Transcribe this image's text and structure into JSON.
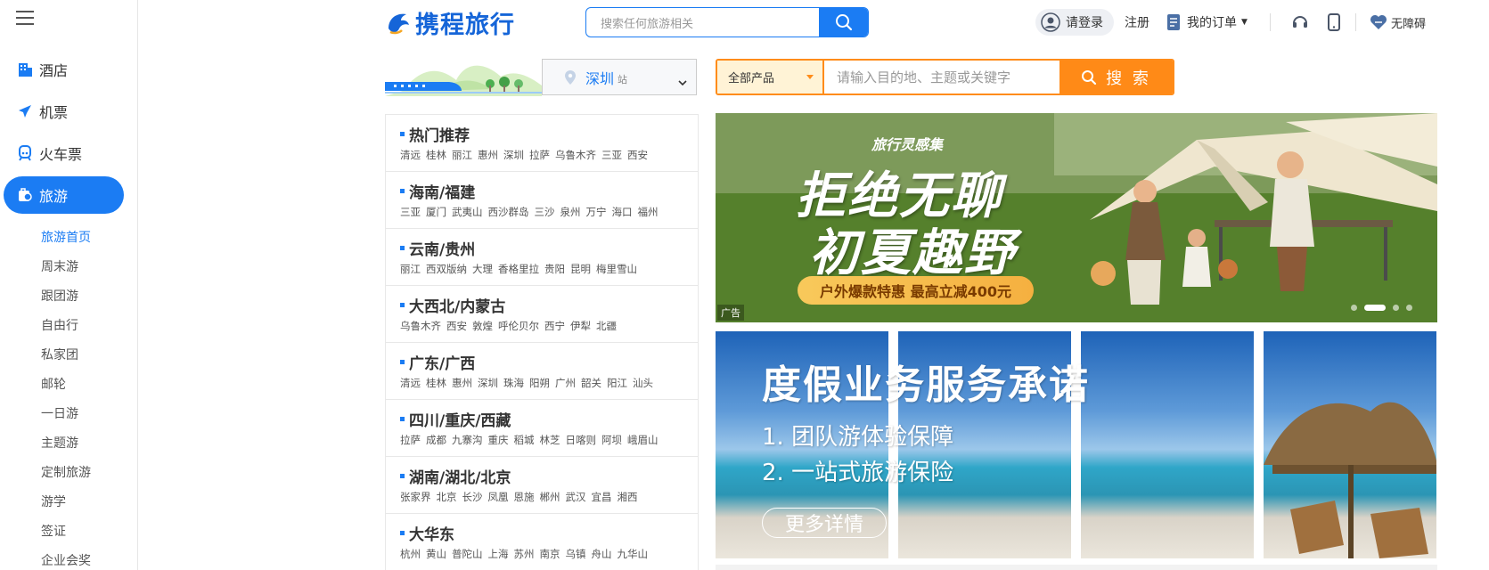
{
  "sidebar": {
    "nav": [
      {
        "label": "酒店",
        "icon": "hotel-icon"
      },
      {
        "label": "机票",
        "icon": "airplane-icon"
      },
      {
        "label": "火车票",
        "icon": "train-icon"
      },
      {
        "label": "旅游",
        "icon": "travel-icon",
        "active": true
      }
    ],
    "sub": [
      {
        "label": "旅游首页",
        "active": true
      },
      {
        "label": "周末游"
      },
      {
        "label": "跟团游"
      },
      {
        "label": "自由行"
      },
      {
        "label": "私家团"
      },
      {
        "label": "邮轮"
      },
      {
        "label": "一日游"
      },
      {
        "label": "主题游"
      },
      {
        "label": "定制旅游"
      },
      {
        "label": "游学"
      },
      {
        "label": "签证"
      },
      {
        "label": "企业会奖"
      }
    ]
  },
  "header": {
    "logo_text": "携程旅行",
    "search_placeholder": "搜索任何旅游相关",
    "login": "请登录",
    "register": "注册",
    "orders": "我的订单",
    "accessibility": "无障碍"
  },
  "station": {
    "city": "深圳",
    "suffix": "站"
  },
  "product_search": {
    "type": "全部产品",
    "placeholder": "请输入目的地、主题或关键字",
    "button": "搜 索"
  },
  "destinations": [
    {
      "title": "热门推荐",
      "cities": [
        "清远",
        "桂林",
        "丽江",
        "惠州",
        "深圳",
        "拉萨",
        "乌鲁木齐",
        "三亚",
        "西安"
      ]
    },
    {
      "title": "海南/福建",
      "cities": [
        "三亚",
        "厦门",
        "武夷山",
        "西沙群岛",
        "三沙",
        "泉州",
        "万宁",
        "海口",
        "福州"
      ]
    },
    {
      "title": "云南/贵州",
      "cities": [
        "丽江",
        "西双版纳",
        "大理",
        "香格里拉",
        "贵阳",
        "昆明",
        "梅里雪山"
      ]
    },
    {
      "title": "大西北/内蒙古",
      "cities": [
        "乌鲁木齐",
        "西安",
        "敦煌",
        "呼伦贝尔",
        "西宁",
        "伊犁",
        "北疆"
      ]
    },
    {
      "title": "广东/广西",
      "cities": [
        "清远",
        "桂林",
        "惠州",
        "深圳",
        "珠海",
        "阳朔",
        "广州",
        "韶关",
        "阳江",
        "汕头"
      ]
    },
    {
      "title": "四川/重庆/西藏",
      "cities": [
        "拉萨",
        "成都",
        "九寨沟",
        "重庆",
        "稻城",
        "林芝",
        "日喀则",
        "阿坝",
        "峨眉山"
      ]
    },
    {
      "title": "湖南/湖北/北京",
      "cities": [
        "张家界",
        "北京",
        "长沙",
        "凤凰",
        "恩施",
        "郴州",
        "武汉",
        "宜昌",
        "湘西"
      ]
    },
    {
      "title": "大华东",
      "cities": [
        "杭州",
        "黄山",
        "普陀山",
        "上海",
        "苏州",
        "南京",
        "乌镇",
        "舟山",
        "九华山"
      ]
    }
  ],
  "hero": {
    "tag": "旅行灵感集",
    "line1": "拒绝无聊",
    "line2": "初夏趣野",
    "promo": "户外爆款特惠 最高立减400元",
    "ad_label": "广告",
    "active_slide": 2,
    "slide_count": 4
  },
  "promise": {
    "title": "度假业务服务承诺",
    "items": [
      "1. 团队游体验保障",
      "2. 一站式旅游保险"
    ],
    "button": "更多详情"
  },
  "colors": {
    "primary": "#1b7cf3",
    "orange": "#ff8a17"
  }
}
